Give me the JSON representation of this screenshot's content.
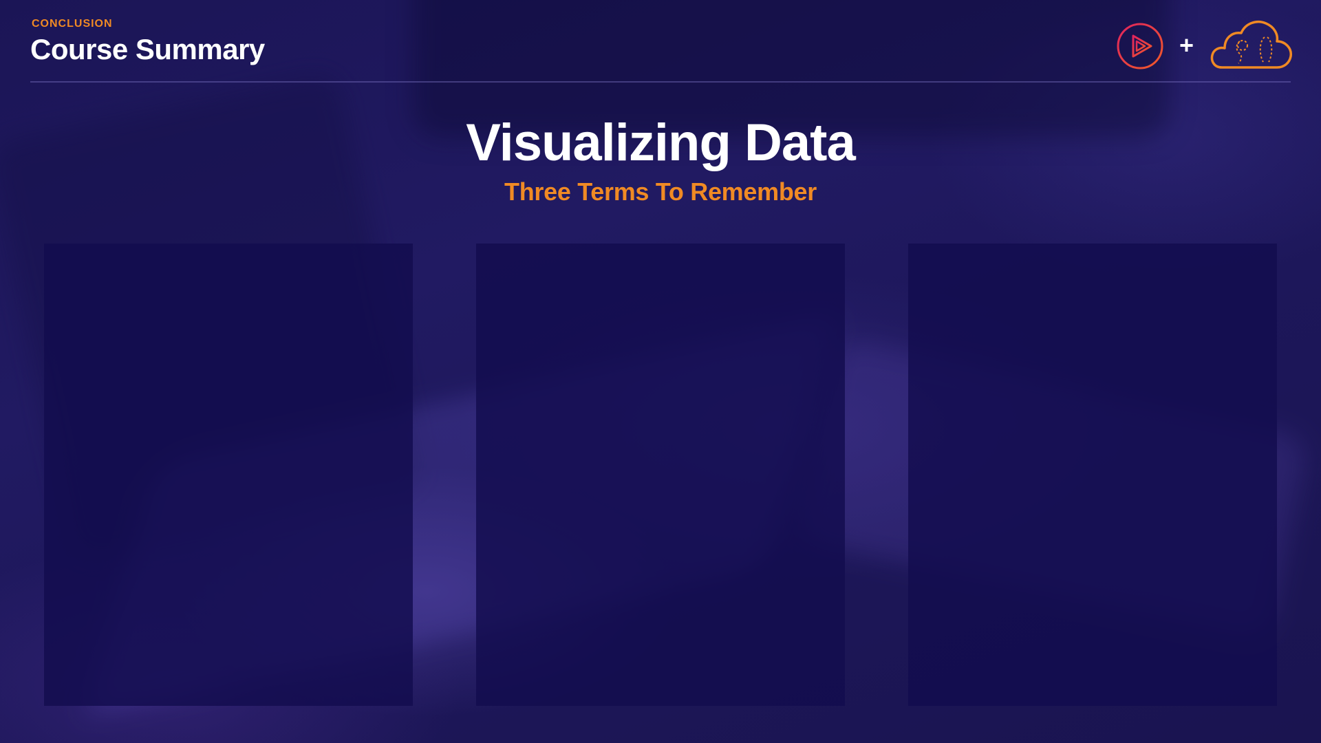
{
  "header": {
    "kicker": "CONCLUSION",
    "title": "Course Summary"
  },
  "logos": {
    "play": "play-logo-icon",
    "plus": "+",
    "cloud": "cloud-logo-icon"
  },
  "main": {
    "title": "Visualizing Data",
    "subtitle": "Three Terms To Remember"
  },
  "panels": [
    {
      "label": ""
    },
    {
      "label": ""
    },
    {
      "label": ""
    }
  ],
  "colors": {
    "background": "#1d175a",
    "accent_orange": "#f08a24",
    "accent_pink": "#e0245e",
    "panel": "#120c4e",
    "text": "#ffffff"
  }
}
